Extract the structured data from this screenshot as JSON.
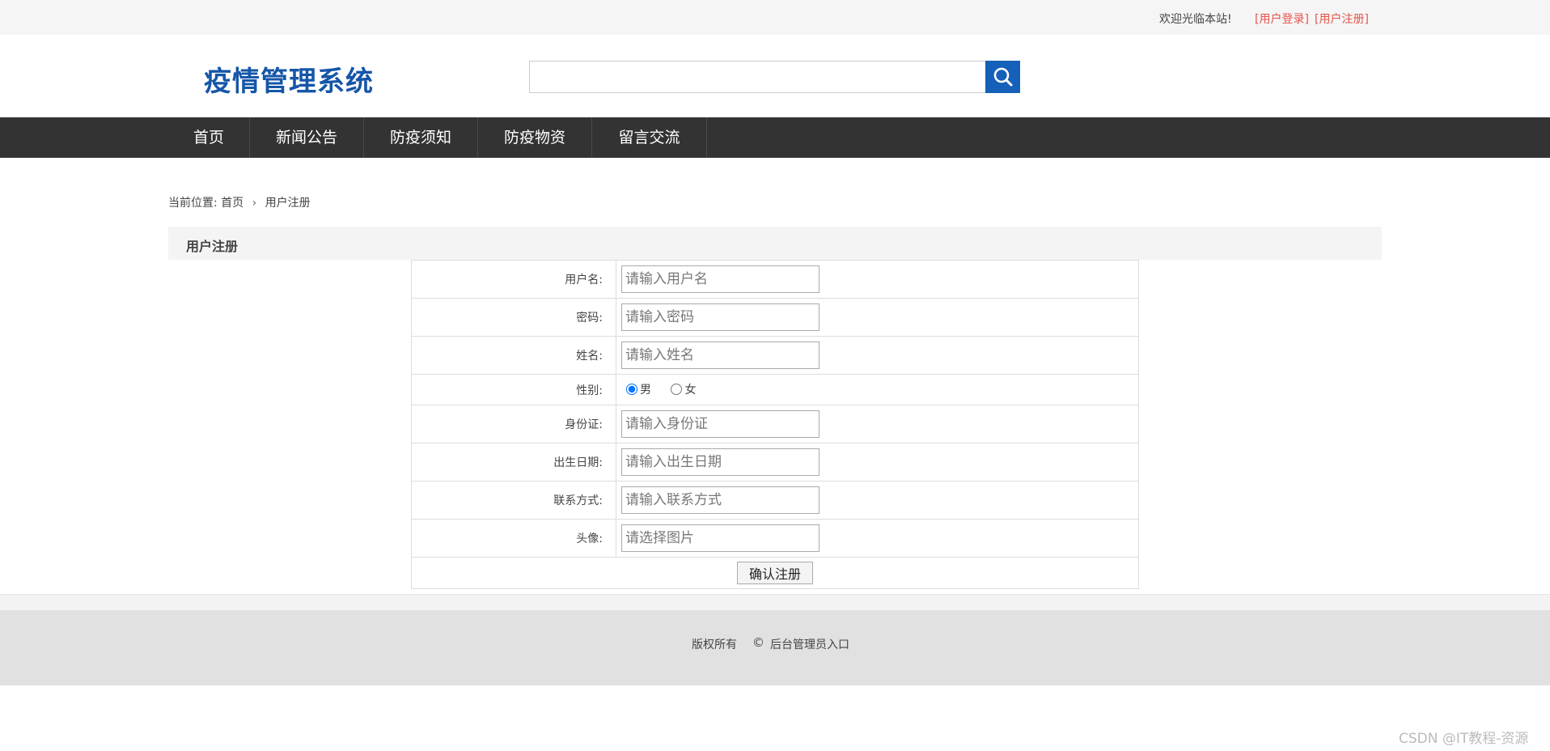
{
  "topbar": {
    "welcome": "欢迎光临本站!",
    "login_link": "[用户登录]",
    "register_link": "[用户注册]"
  },
  "header": {
    "logo": "疫情管理系统",
    "search_placeholder": "",
    "search_icon": "search-icon"
  },
  "nav": {
    "items": [
      "首页",
      "新闻公告",
      "防疫须知",
      "防疫物资",
      "留言交流"
    ]
  },
  "breadcrumb": {
    "prefix": "当前位置:",
    "home": "首页",
    "current": "用户注册"
  },
  "section": {
    "title": "用户注册"
  },
  "form": {
    "fields": [
      {
        "label": "用户名:",
        "placeholder": "请输入用户名"
      },
      {
        "label": "密码:",
        "placeholder": "请输入密码"
      },
      {
        "label": "姓名:",
        "placeholder": "请输入姓名"
      },
      {
        "label": "身份证:",
        "placeholder": "请输入身份证"
      },
      {
        "label": "出生日期:",
        "placeholder": "请输入出生日期"
      },
      {
        "label": "联系方式:",
        "placeholder": "请输入联系方式"
      },
      {
        "label": "头像:",
        "placeholder": "请选择图片"
      }
    ],
    "gender": {
      "label": "性别:",
      "options": [
        "男",
        "女"
      ],
      "selected": "男"
    },
    "submit_label": "确认注册"
  },
  "footer": {
    "copyright": "版权所有",
    "symbol": "©",
    "admin_link": "后台管理员入口"
  },
  "watermark": "CSDN @IT教程-资源",
  "colors": {
    "logo": "#1556a8",
    "search_button": "#1560b8",
    "nav_bg": "#333333",
    "topbar_link": "#e5534b"
  }
}
